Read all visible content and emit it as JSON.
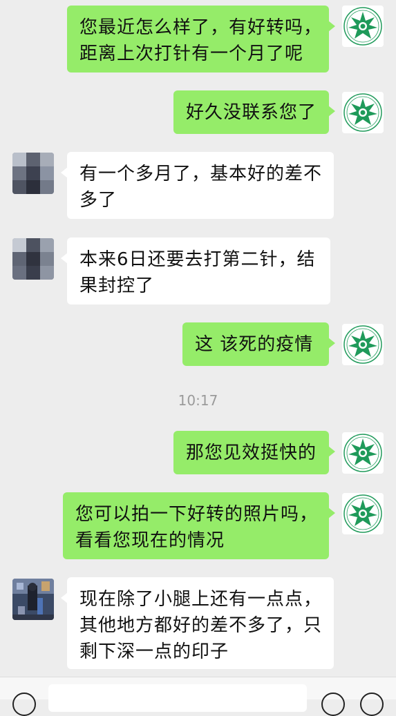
{
  "messages": [
    {
      "side": "me",
      "lines": [
        "您最近怎么样了，有好转吗，",
        "距离上次打针有一个月了呢"
      ]
    },
    {
      "side": "me",
      "lines": [
        "好久没联系您了"
      ]
    },
    {
      "side": "other",
      "lines": [
        "有一个多月了，基本好的差不",
        "多了"
      ]
    },
    {
      "side": "other",
      "lines": [
        "本来6日还要去打第二针，结",
        "果封控了"
      ]
    },
    {
      "side": "me",
      "lines": [
        "这 该死的疫情"
      ]
    },
    {
      "side": "me",
      "lines": [
        "那您见效挺快的"
      ]
    },
    {
      "side": "me",
      "lines": [
        "您可以拍一下好转的照片吗，",
        "看看您现在的情况"
      ]
    },
    {
      "side": "other",
      "lines": [
        "现在除了小腿上还有一点点，",
        "其他地方都好的差不多了，只",
        "剩下深一点的印子"
      ]
    }
  ],
  "timestamp": "10:17",
  "colors": {
    "background": "#ededed",
    "my_bubble": "#95ec69",
    "their_bubble": "#ffffff",
    "logo_green": "#1f9a5a"
  },
  "icons": {
    "my_avatar": "green-star-logo-icon",
    "their_avatar": "blurred-photo-avatar",
    "voice": "voice-icon",
    "emoji": "emoji-icon",
    "plus": "plus-icon"
  }
}
